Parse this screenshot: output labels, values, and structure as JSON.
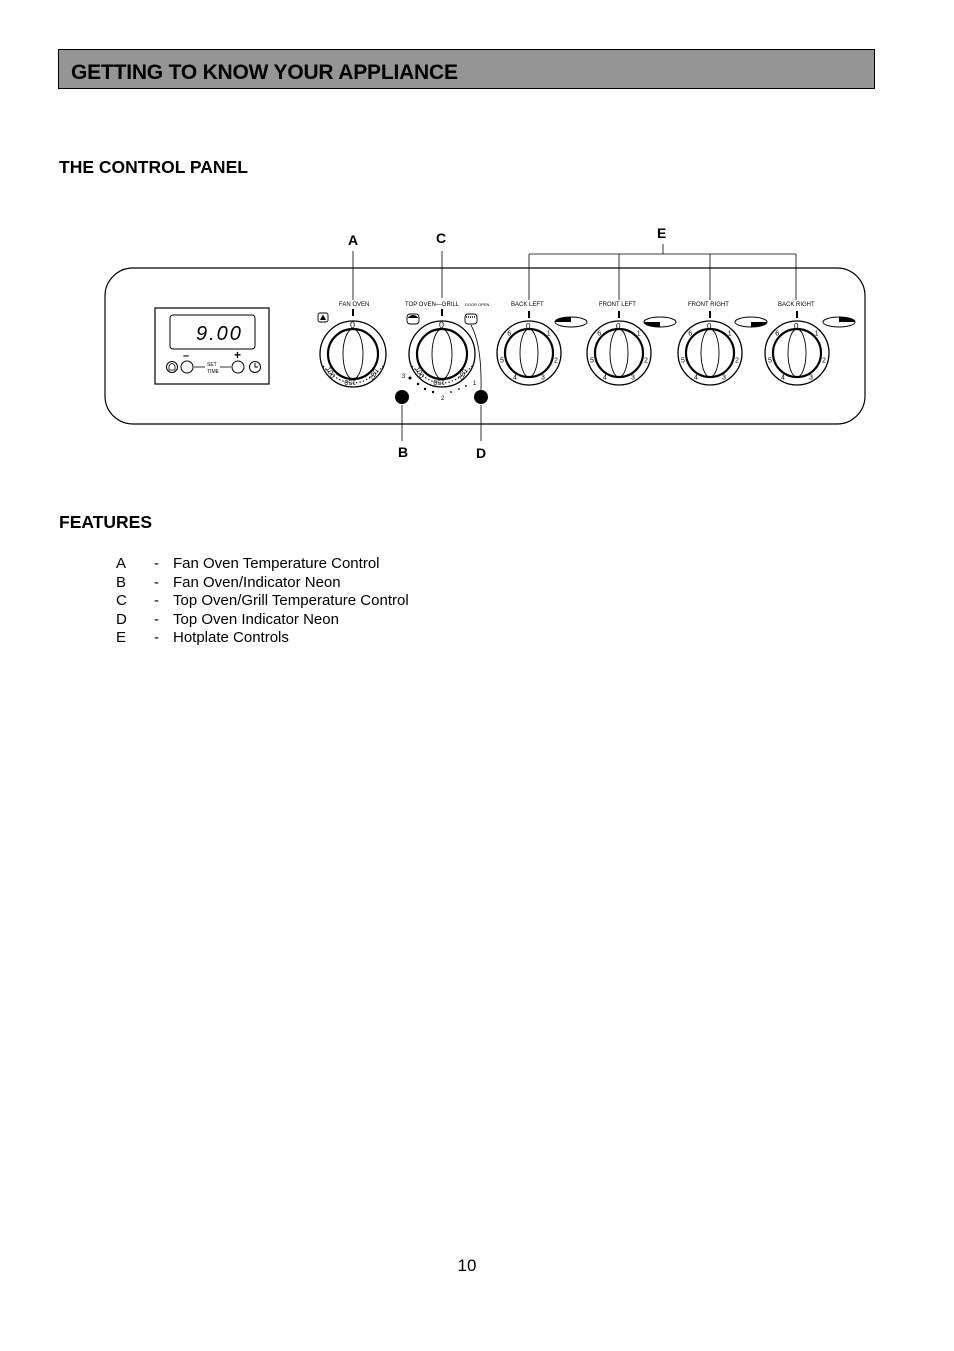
{
  "page": {
    "title": "GETTING TO KNOW YOUR APPLIANCE",
    "page_number": "10"
  },
  "control_panel": {
    "heading": "THE CONTROL PANEL",
    "callouts": {
      "A": "A",
      "B": "B",
      "C": "C",
      "D": "D",
      "E": "E"
    },
    "timer": {
      "display": "9.00",
      "minus": "–",
      "plus": "+",
      "set_label_top": "SET",
      "set_label_bottom": "TIME",
      "icons": [
        "bell-icon",
        "clock-icon"
      ]
    },
    "fan_oven": {
      "label": "FAN OVEN",
      "zero": "0",
      "scale": [
        "100",
        "150",
        "220"
      ],
      "icon": "fan-icon"
    },
    "top_oven_grill": {
      "label": "TOP OVEN—GRILL",
      "door_label": "DOOR OPEN",
      "zero": "0",
      "scale": [
        "100",
        "150",
        "220"
      ],
      "grill_scale": [
        "3",
        "2",
        "1"
      ],
      "icons": [
        "top-oven-icon",
        "grill-icon"
      ]
    },
    "hotplates": [
      {
        "label": "BACK LEFT",
        "zero": "0",
        "indicator": "back-left"
      },
      {
        "label": "FRONT LEFT",
        "zero": "0",
        "indicator": "front-left"
      },
      {
        "label": "FRONT RIGHT",
        "zero": "0",
        "indicator": "front-right"
      },
      {
        "label": "BACK RIGHT",
        "zero": "0",
        "indicator": "back-right"
      }
    ],
    "hotplate_scale": [
      "1",
      "2",
      "3",
      "4",
      "5",
      "6"
    ]
  },
  "features": {
    "heading": "FEATURES",
    "items": [
      {
        "letter": "A",
        "dash": "-",
        "text": "Fan Oven Temperature Control"
      },
      {
        "letter": "B",
        "dash": "-",
        "text": "Fan Oven/Indicator Neon"
      },
      {
        "letter": "C",
        "dash": "-",
        "text": "Top Oven/Grill Temperature Control"
      },
      {
        "letter": "D",
        "dash": "-",
        "text": "Top Oven Indicator Neon"
      },
      {
        "letter": "E",
        "dash": "-",
        "text": "Hotplate Controls"
      }
    ]
  }
}
